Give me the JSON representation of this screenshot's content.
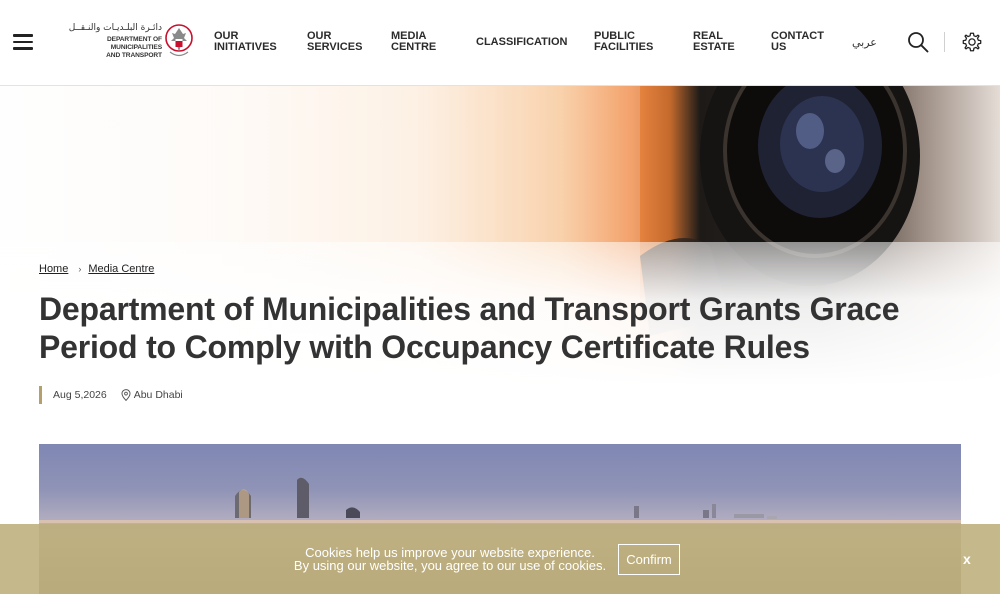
{
  "header": {
    "logo": {
      "text_ar": "دائـرة البلـديـات والنـقــل",
      "text_en_line1": "DEPARTMENT OF MUNICIPALITIES",
      "text_en_line2": "AND TRANSPORT"
    },
    "nav": [
      {
        "label": "OUR\nINITIATIVES"
      },
      {
        "label": "OUR\nSERVICES"
      },
      {
        "label": "MEDIA\nCENTRE"
      },
      {
        "label": "CLASSIFICATION"
      },
      {
        "label": "PUBLIC\nFACILITIES"
      },
      {
        "label": "REAL\nESTATE"
      },
      {
        "label": "CONTACT\nUS"
      }
    ],
    "language_toggle": "عربي",
    "icons": {
      "menu": "hamburger-menu-icon",
      "search": "search-icon",
      "settings": "gear-icon"
    }
  },
  "breadcrumb": {
    "home": "Home",
    "separator": "›",
    "current": "Media Centre"
  },
  "article": {
    "title": "Department of Municipalities and Transport Grants Grace Period to Comply with Occupancy Certificate Rules",
    "date": "Aug 5,2026",
    "location": "Abu Dhabi"
  },
  "cookie_banner": {
    "line1": "Cookies help us improve your website experience.",
    "line2": "By using our website, you agree to our use of cookies.",
    "confirm_label": "Confirm",
    "close_label": "x"
  },
  "colors": {
    "accent_gold": "#b59f6a",
    "cookie_bg": "#bdae7b",
    "text_dark": "#333333"
  }
}
